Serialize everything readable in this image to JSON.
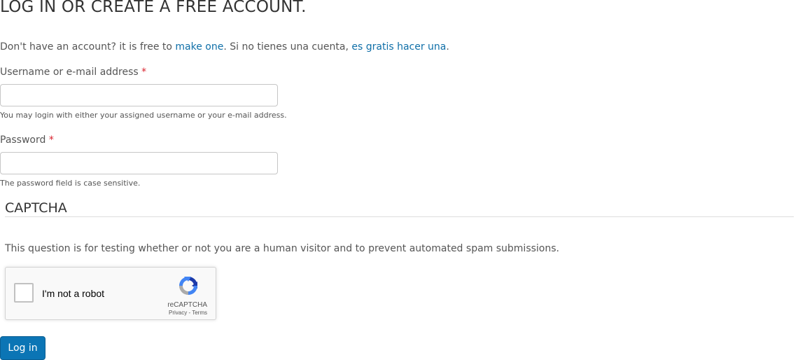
{
  "header": {
    "title": "LOG IN OR CREATE A FREE ACCOUNT."
  },
  "intro": {
    "text1": "Don't have an account? it is free to ",
    "link1": "make one",
    "text2": ". Si no tienes una cuenta, ",
    "link2": "es gratis hacer una",
    "text3": "."
  },
  "username": {
    "label": "Username or e-mail address",
    "required_mark": "*",
    "value": "",
    "placeholder": "",
    "description": "You may login with either your assigned username or your e-mail address."
  },
  "password": {
    "label": "Password",
    "required_mark": "*",
    "value": "",
    "placeholder": "",
    "description": "The password field is case sensitive."
  },
  "captcha": {
    "legend": "CAPTCHA",
    "description": "This question is for testing whether or not you are a human visitor and to prevent automated spam submissions.",
    "widget": {
      "checkbox_label": "I'm not a robot",
      "brand": "reCAPTCHA",
      "privacy_link": "Privacy",
      "separator": " - ",
      "terms_link": "Terms",
      "logo_icon": "recaptcha-logo-icon"
    }
  },
  "actions": {
    "login_label": "Log in"
  },
  "colors": {
    "link": "#0f6fa8",
    "required": "#d9232e",
    "button": "#0b75b5"
  }
}
